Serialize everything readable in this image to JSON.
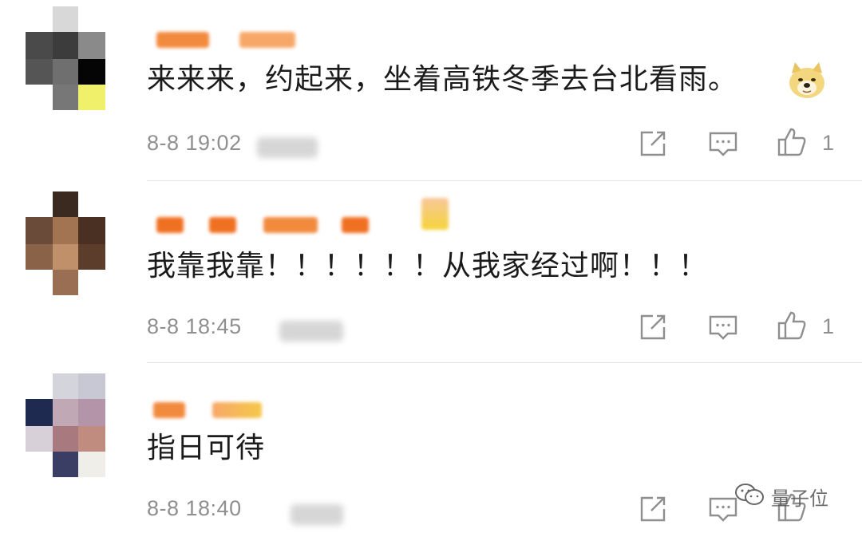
{
  "comments": [
    {
      "text": "来来来，约起来，坐着高铁冬季去台北看雨。",
      "time": "8-8 19:02",
      "likes": "1",
      "emoji_icon": "doge-emoji-icon"
    },
    {
      "text": "我靠我靠！！！！！！从我家经过啊！！！",
      "time": "8-8 18:45",
      "likes": "1"
    },
    {
      "text": "指日可待",
      "time": "8-8 18:40",
      "likes": ""
    }
  ],
  "actions": {
    "share_icon": "share-icon",
    "reply_icon": "comment-icon",
    "like_icon": "thumbs-up-icon"
  },
  "watermark": {
    "text": "量子位",
    "icon": "wechat-icon"
  },
  "colors": {
    "text": "#1b1b1b",
    "meta": "#8f8f8f",
    "name_blur": "#f07a2a"
  }
}
